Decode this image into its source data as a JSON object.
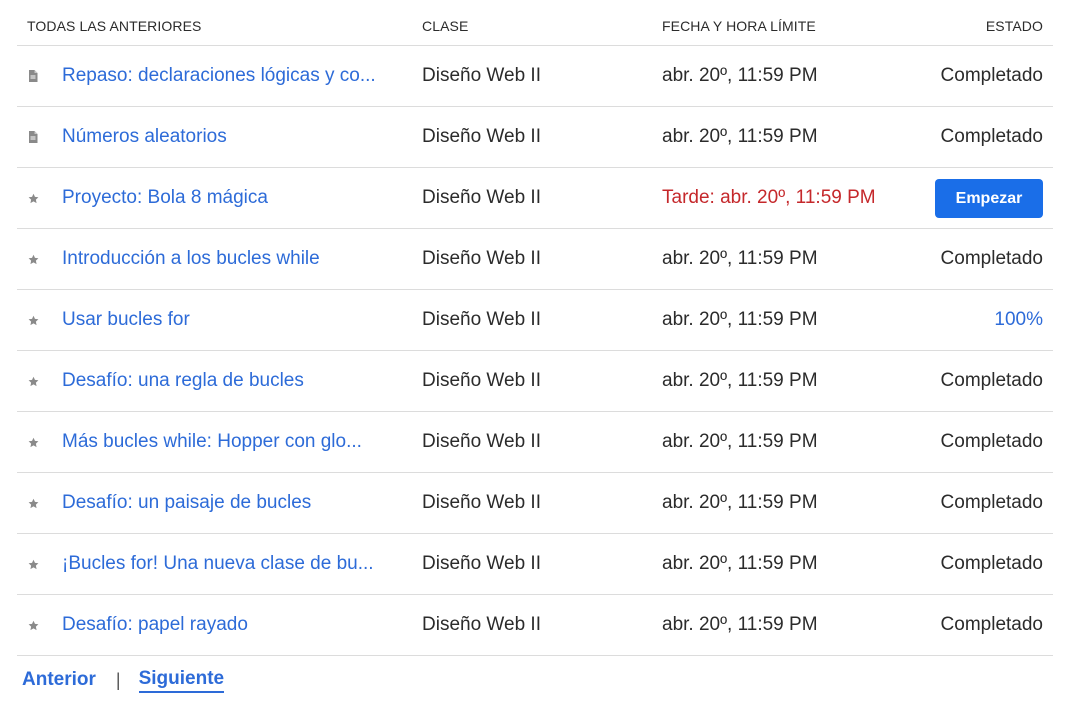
{
  "headers": {
    "name": "TODAS LAS ANTERIORES",
    "class": "CLASE",
    "due": "FECHA Y HORA LÍMITE",
    "status": "ESTADO"
  },
  "rows": [
    {
      "icon": "document-icon",
      "name": "Repaso: declaraciones lógicas y co...",
      "class": "Diseño Web II",
      "due": "abr. 20º, 11:59 PM",
      "late": false,
      "status": "Completado",
      "status_type": "text"
    },
    {
      "icon": "document-icon",
      "name": "Números aleatorios",
      "class": "Diseño Web II",
      "due": "abr. 20º, 11:59 PM",
      "late": false,
      "status": "Completado",
      "status_type": "text"
    },
    {
      "icon": "star-icon",
      "name": "Proyecto: Bola 8 mágica",
      "class": "Diseño Web II",
      "due": "Tarde: abr. 20º, 11:59 PM",
      "late": true,
      "status": "Empezar",
      "status_type": "button"
    },
    {
      "icon": "star-icon",
      "name": "Introducción a los bucles while",
      "class": "Diseño Web II",
      "due": "abr. 20º, 11:59 PM",
      "late": false,
      "status": "Completado",
      "status_type": "text"
    },
    {
      "icon": "star-icon",
      "name": "Usar bucles for",
      "class": "Diseño Web II",
      "due": "abr. 20º, 11:59 PM",
      "late": false,
      "status": "100%",
      "status_type": "percent"
    },
    {
      "icon": "star-icon",
      "name": "Desafío: una regla de bucles",
      "class": "Diseño Web II",
      "due": "abr. 20º, 11:59 PM",
      "late": false,
      "status": "Completado",
      "status_type": "text"
    },
    {
      "icon": "star-icon",
      "name": "Más bucles while: Hopper con glo...",
      "class": "Diseño Web II",
      "due": "abr. 20º, 11:59 PM",
      "late": false,
      "status": "Completado",
      "status_type": "text"
    },
    {
      "icon": "star-icon",
      "name": "Desafío: un paisaje de bucles",
      "class": "Diseño Web II",
      "due": "abr. 20º, 11:59 PM",
      "late": false,
      "status": "Completado",
      "status_type": "text"
    },
    {
      "icon": "star-icon",
      "name": "¡Bucles for! Una nueva clase de bu...",
      "class": "Diseño Web II",
      "due": "abr. 20º, 11:59 PM",
      "late": false,
      "status": "Completado",
      "status_type": "text"
    },
    {
      "icon": "star-icon",
      "name": "Desafío: papel rayado",
      "class": "Diseño Web II",
      "due": "abr. 20º, 11:59 PM",
      "late": false,
      "status": "Completado",
      "status_type": "text"
    }
  ],
  "pager": {
    "prev_label": "Anterior",
    "separator": "|",
    "next_label": "Siguiente"
  },
  "colors": {
    "link": "#2d6bd8",
    "late": "#c5282b",
    "button": "#1a6ee8",
    "icon": "#8a8a8a",
    "divider": "#dcdcdc"
  }
}
